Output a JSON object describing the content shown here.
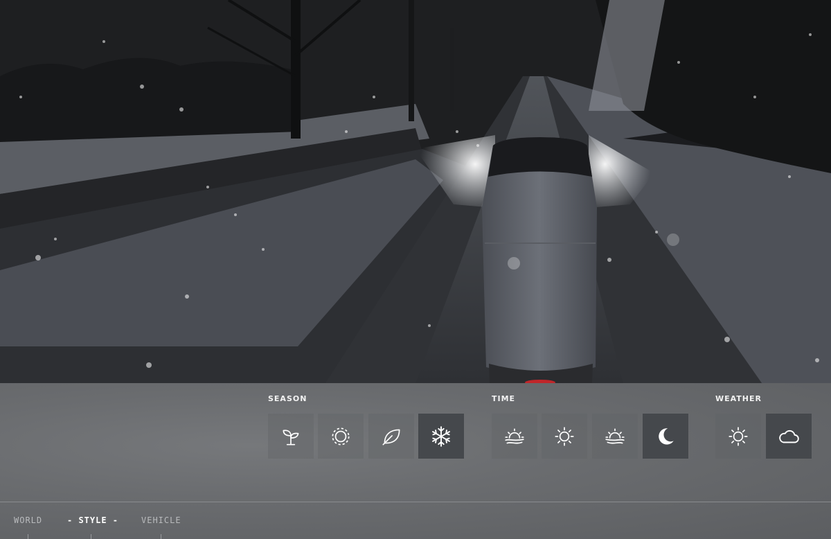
{
  "panel": {
    "season": {
      "label": "SEASON",
      "options": [
        {
          "name": "spring",
          "icon": "sprout-icon",
          "active": false
        },
        {
          "name": "summer",
          "icon": "sun-icon",
          "active": false
        },
        {
          "name": "autumn",
          "icon": "leaf-icon",
          "active": false
        },
        {
          "name": "winter",
          "icon": "snowflake-icon",
          "active": true
        }
      ]
    },
    "time": {
      "label": "TIME",
      "options": [
        {
          "name": "sunrise",
          "icon": "sunrise-icon",
          "active": false
        },
        {
          "name": "day",
          "icon": "sun-icon",
          "active": false
        },
        {
          "name": "sunset",
          "icon": "sunset-icon",
          "active": false
        },
        {
          "name": "night",
          "icon": "moon-icon",
          "active": true
        }
      ]
    },
    "weather": {
      "label": "WEATHER",
      "options": [
        {
          "name": "clear",
          "icon": "sun-icon",
          "active": false
        },
        {
          "name": "cloudy",
          "icon": "cloud-icon",
          "active": true
        }
      ]
    }
  },
  "nav": {
    "world": "WORLD",
    "style": "- STYLE -",
    "vehicle": "VEHICLE"
  },
  "colors": {
    "panel_bg": "#6a6c6f",
    "active_option": "#45484c",
    "icon": "#ffffff"
  }
}
